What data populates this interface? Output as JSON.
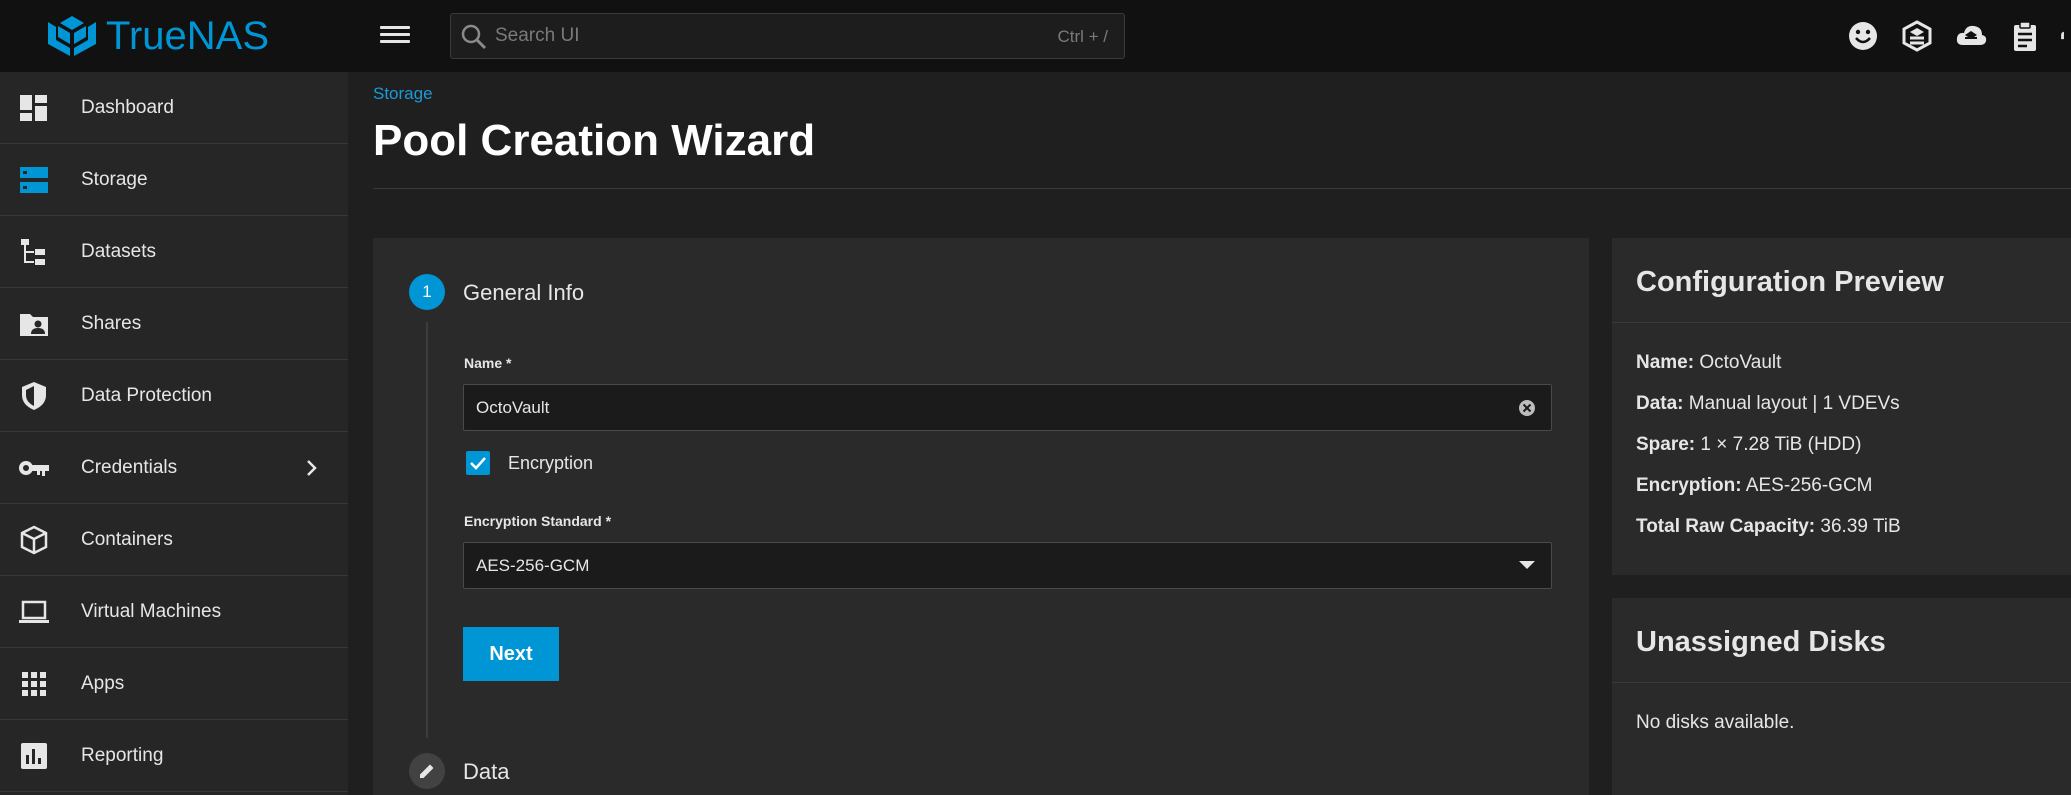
{
  "brand": {
    "name": "TrueNAS",
    "accent": "#0095d5"
  },
  "search": {
    "placeholder": "Search UI",
    "shortcut": "Ctrl + /"
  },
  "top_icons": [
    "smiley-icon",
    "truecommand-icon",
    "cloud-sync-icon",
    "clipboard-icon",
    "bell-icon"
  ],
  "sidebar": {
    "items": [
      {
        "label": "Dashboard",
        "icon": "dashboard-icon"
      },
      {
        "label": "Storage",
        "icon": "storage-icon",
        "active": true
      },
      {
        "label": "Datasets",
        "icon": "datasets-icon"
      },
      {
        "label": "Shares",
        "icon": "shares-icon"
      },
      {
        "label": "Data Protection",
        "icon": "shield-icon"
      },
      {
        "label": "Credentials",
        "icon": "key-icon",
        "expandable": true
      },
      {
        "label": "Containers",
        "icon": "cube-icon"
      },
      {
        "label": "Virtual Machines",
        "icon": "laptop-icon"
      },
      {
        "label": "Apps",
        "icon": "apps-grid-icon"
      },
      {
        "label": "Reporting",
        "icon": "bar-chart-icon"
      }
    ]
  },
  "main": {
    "breadcrumb": "Storage",
    "title": "Pool Creation Wizard"
  },
  "wizard": {
    "step1": {
      "number": "1",
      "title": "General Info"
    },
    "name_label": "Name *",
    "name_value": "OctoVault",
    "encryption_label": "Encryption",
    "encryption_checked": true,
    "encryption_standard_label": "Encryption Standard *",
    "encryption_standard_value": "AES-256-GCM",
    "next_label": "Next",
    "step2": {
      "title": "Data"
    }
  },
  "preview": {
    "title": "Configuration Preview",
    "rows": [
      {
        "key": "Name:",
        "value": "OctoVault"
      },
      {
        "key": "Data:",
        "value": "Manual layout | 1 VDEVs"
      },
      {
        "key": "Spare:",
        "value": "1 × 7.28 TiB (HDD)"
      },
      {
        "key": "Encryption:",
        "value": "AES-256-GCM"
      },
      {
        "key": "Total Raw Capacity:",
        "value": "36.39 TiB"
      }
    ]
  },
  "unassigned": {
    "title": "Unassigned Disks",
    "empty_text": "No disks available."
  }
}
